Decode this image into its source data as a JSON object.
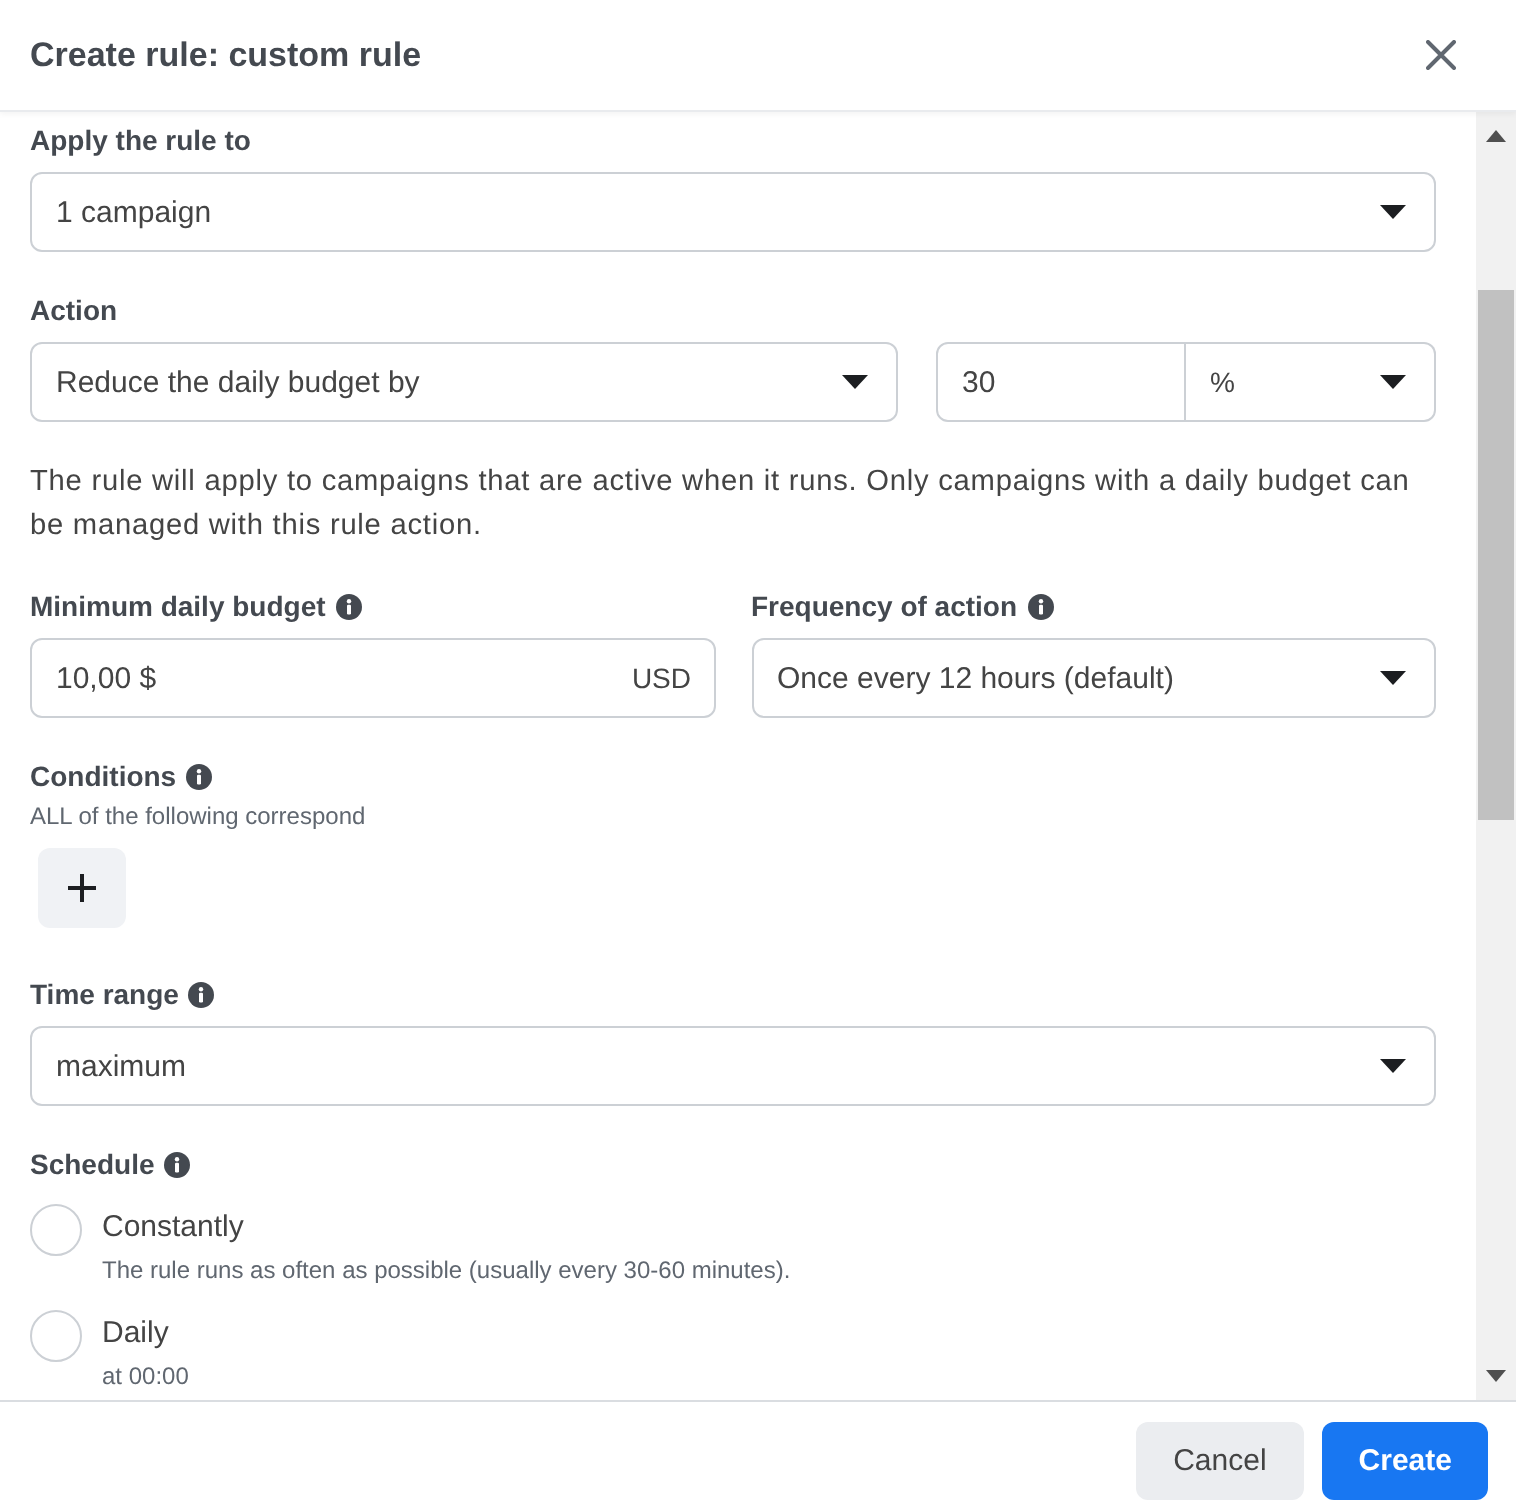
{
  "dialog": {
    "title": "Create rule: custom rule"
  },
  "apply_to": {
    "label": "Apply the rule to",
    "value": "1 campaign"
  },
  "action": {
    "label": "Action",
    "value": "Reduce the daily budget by",
    "amount": "30",
    "unit": "%",
    "note": "The rule will apply to campaigns that are active when it runs. Only campaigns with a daily budget can be managed with this rule action."
  },
  "minimum_daily_budget": {
    "label": "Minimum daily budget",
    "info": true,
    "value": "10,00 $",
    "currency": "USD"
  },
  "frequency": {
    "label": "Frequency of action",
    "info": true,
    "value": "Once every 12 hours (default)"
  },
  "conditions": {
    "label": "Conditions",
    "info": true,
    "subtitle": "ALL of the following correspond"
  },
  "time_range": {
    "label": "Time range",
    "info": true,
    "value": "maximum"
  },
  "schedule": {
    "label": "Schedule",
    "info": true,
    "options": [
      {
        "label": "Constantly",
        "description": "The rule runs as often as possible (usually every 30-60 minutes).",
        "selected": false
      },
      {
        "label": "Daily",
        "description": "at 00:00",
        "selected": false
      }
    ]
  },
  "footer": {
    "buttons": [
      {
        "label": "Cancel",
        "kind": "secondary"
      },
      {
        "label": "Create",
        "kind": "primary"
      }
    ]
  }
}
